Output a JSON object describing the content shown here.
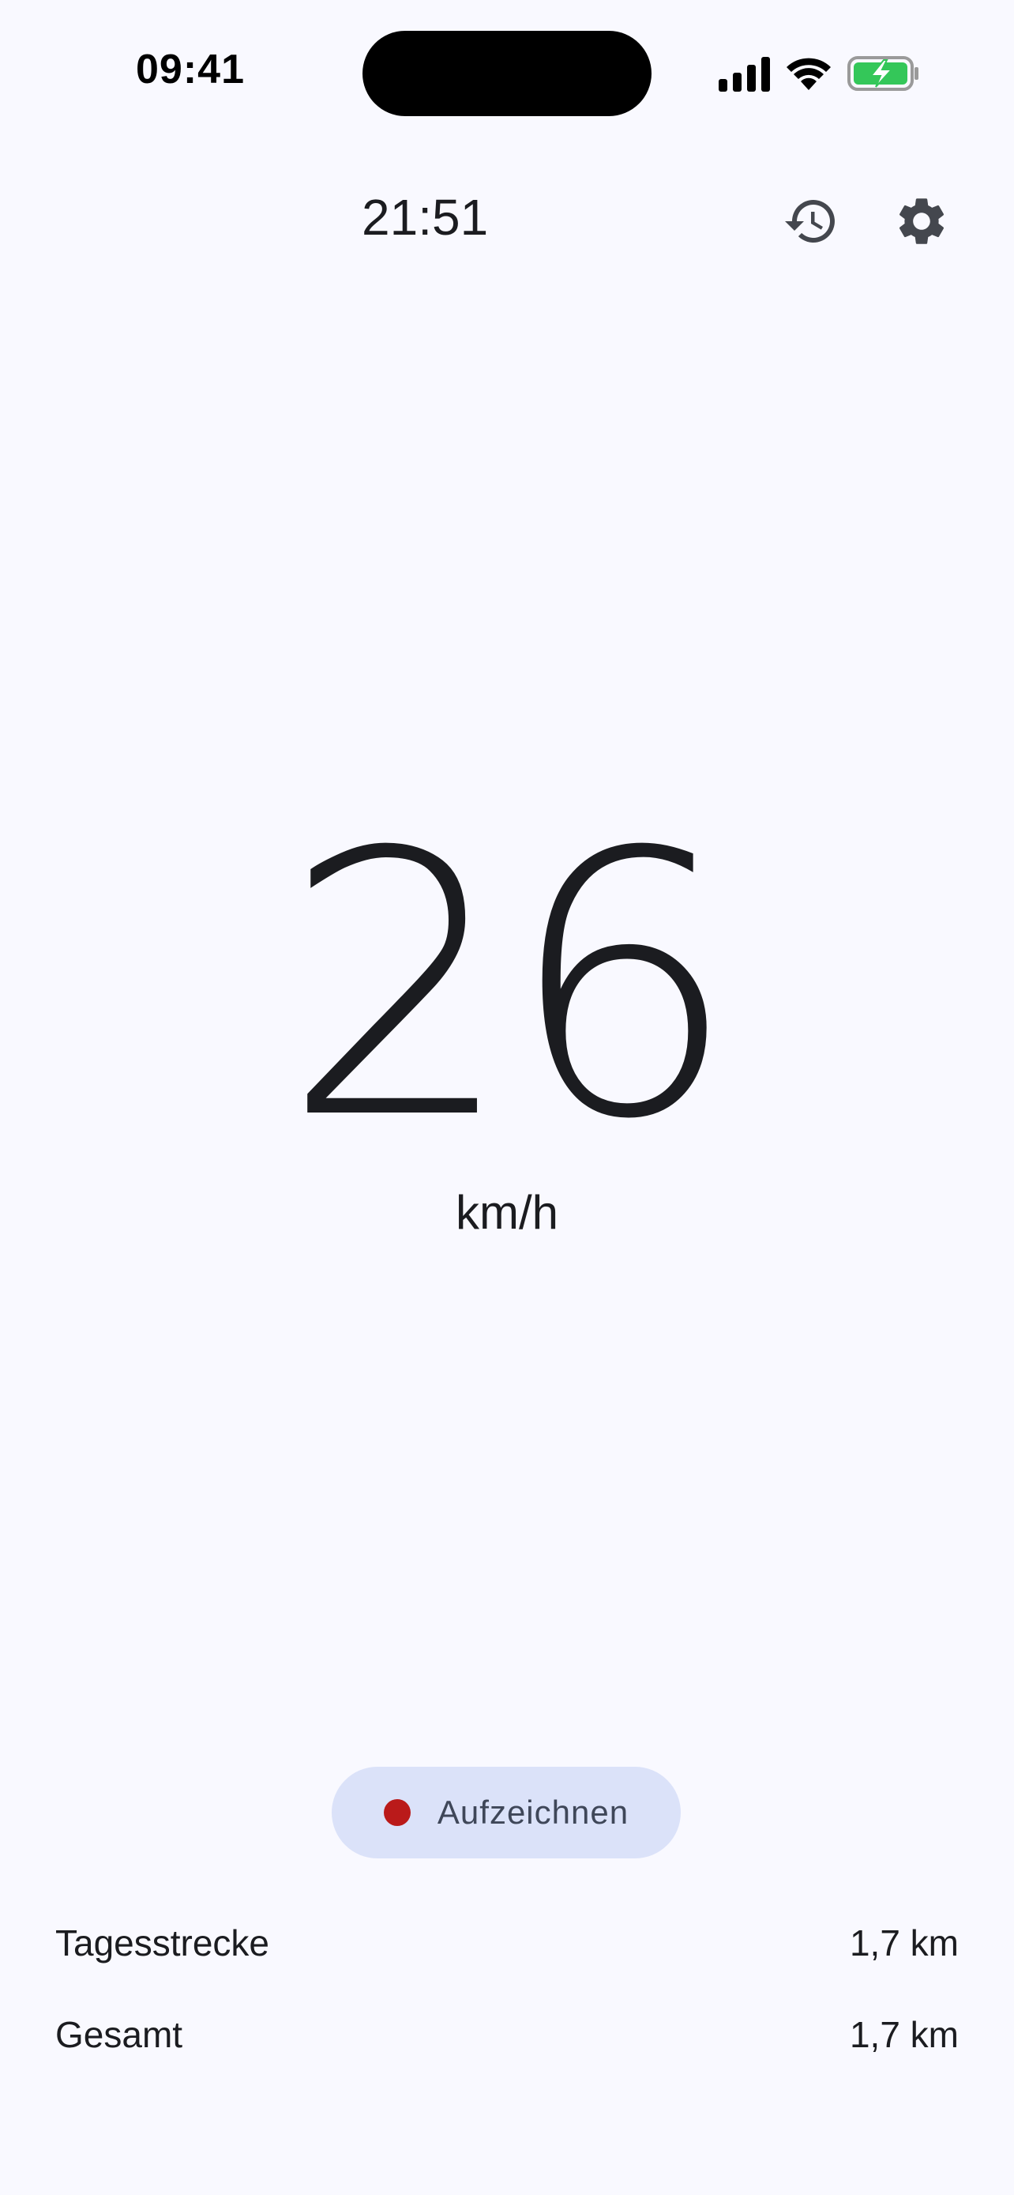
{
  "status_bar": {
    "time": "09:41",
    "icons": [
      "cellular-signal-icon",
      "wifi-icon",
      "battery-charging-icon"
    ],
    "battery_color": "#34c759"
  },
  "header": {
    "clock": "21:51",
    "history_icon": "history-icon",
    "settings_icon": "gear-icon"
  },
  "speedometer": {
    "speed": "26",
    "unit": "km/h"
  },
  "record": {
    "label": "Aufzeichnen",
    "dot_color": "#ba1a1a",
    "button_color": "#dbe2f9"
  },
  "stats": {
    "daily_label": "Tagesstrecke",
    "daily_value": "1,7 km",
    "total_label": "Gesamt",
    "total_value": "1,7 km"
  }
}
